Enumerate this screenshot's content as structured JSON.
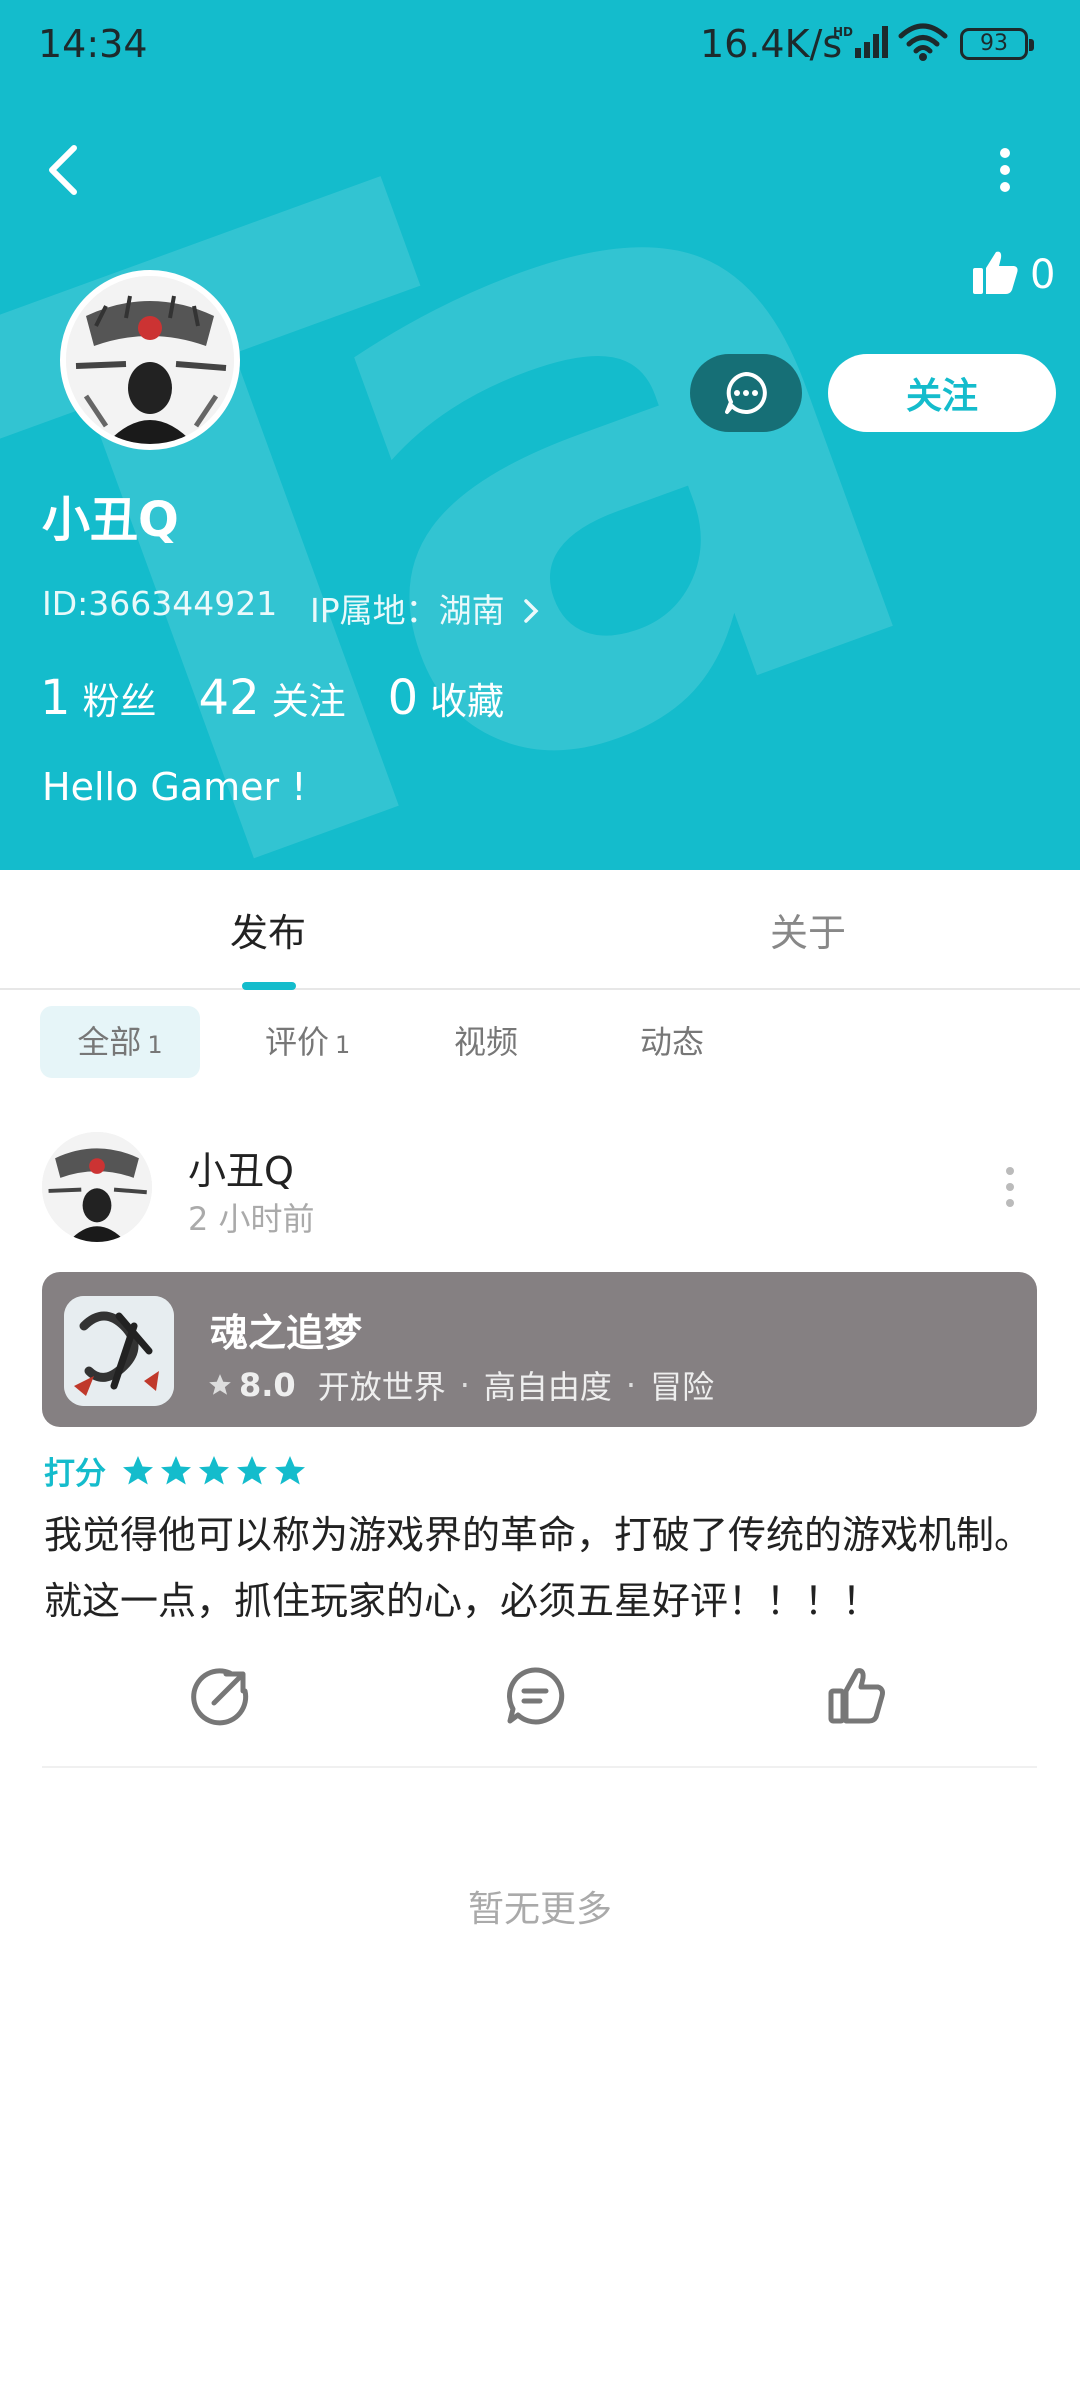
{
  "status_bar": {
    "time": "14:34",
    "net_speed": "16.4K/s",
    "battery": "93"
  },
  "profile": {
    "likes": "0",
    "name": "小丑Q",
    "id_text": "ID:366344921",
    "ip_text": "IP属地：湖南",
    "follow_label": "关注",
    "stats": [
      {
        "num": "1",
        "label": "粉丝"
      },
      {
        "num": "42",
        "label": "关注"
      },
      {
        "num": "0",
        "label": "收藏"
      }
    ],
    "bio": "Hello Gamer !"
  },
  "tabs": {
    "publish": "发布",
    "about": "关于"
  },
  "filters": [
    {
      "label": "全部",
      "count": "1"
    },
    {
      "label": "评价",
      "count": "1"
    },
    {
      "label": "视频",
      "count": ""
    },
    {
      "label": "动态",
      "count": ""
    }
  ],
  "post": {
    "author": "小丑Q",
    "time": "2 小时前",
    "game": {
      "name": "魂之追梦",
      "score": "8.0",
      "tags": [
        "开放世界",
        "高自由度",
        "冒险"
      ]
    },
    "rating_label": "打分",
    "rating_stars": 5,
    "text": "我觉得他可以称为游戏界的革命，打破了传统的游戏机制。就这一点，抓住玩家的心，必须五星好评！！！！"
  },
  "footer": {
    "no_more": "暂无更多"
  },
  "colors": {
    "accent": "#14bccc",
    "header_bg": "#14bccc",
    "message_button": "#166f76",
    "game_card": "#858082"
  }
}
